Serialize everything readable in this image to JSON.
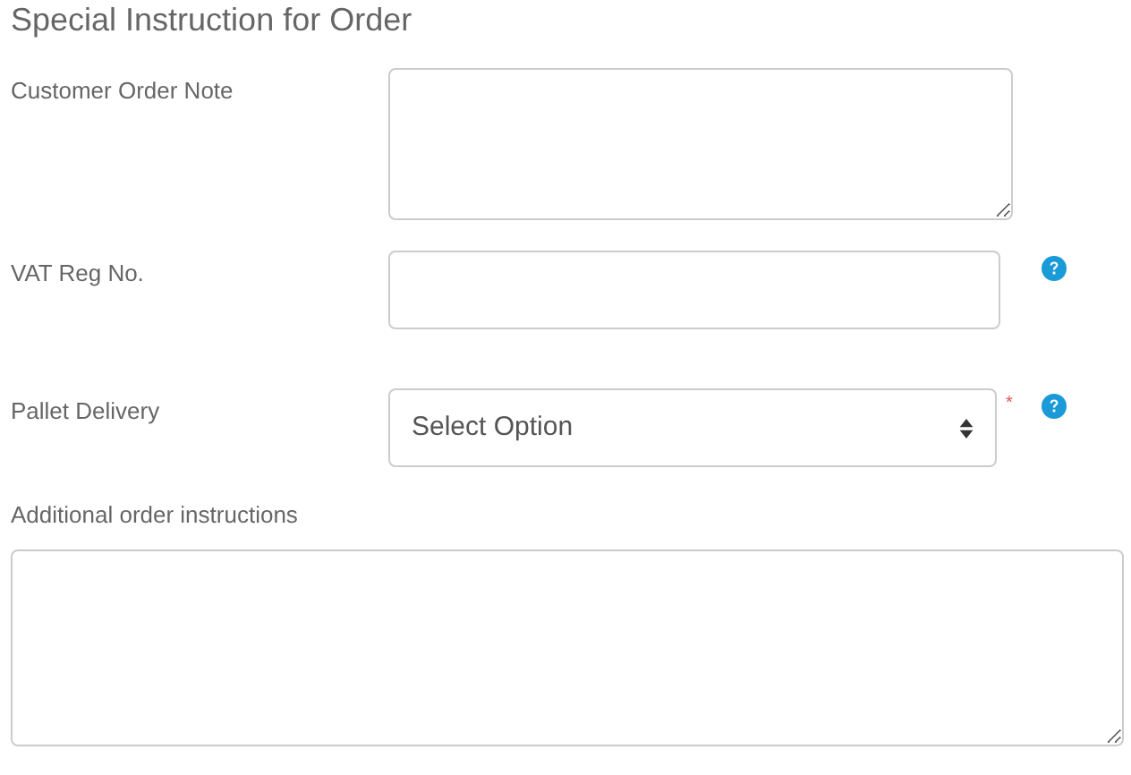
{
  "title": "Special Instruction for Order",
  "fields": [
    {
      "label": "Customer Order Note",
      "kind": "textarea",
      "help": false
    },
    {
      "label": "VAT Reg No.",
      "kind": "input",
      "help": true
    },
    {
      "label": "Pallet Delivery",
      "kind": "select",
      "value": "Select Option",
      "required_mark": "*",
      "help": true
    }
  ],
  "additional": {
    "label": "Additional order instructions",
    "kind": "textarea"
  }
}
